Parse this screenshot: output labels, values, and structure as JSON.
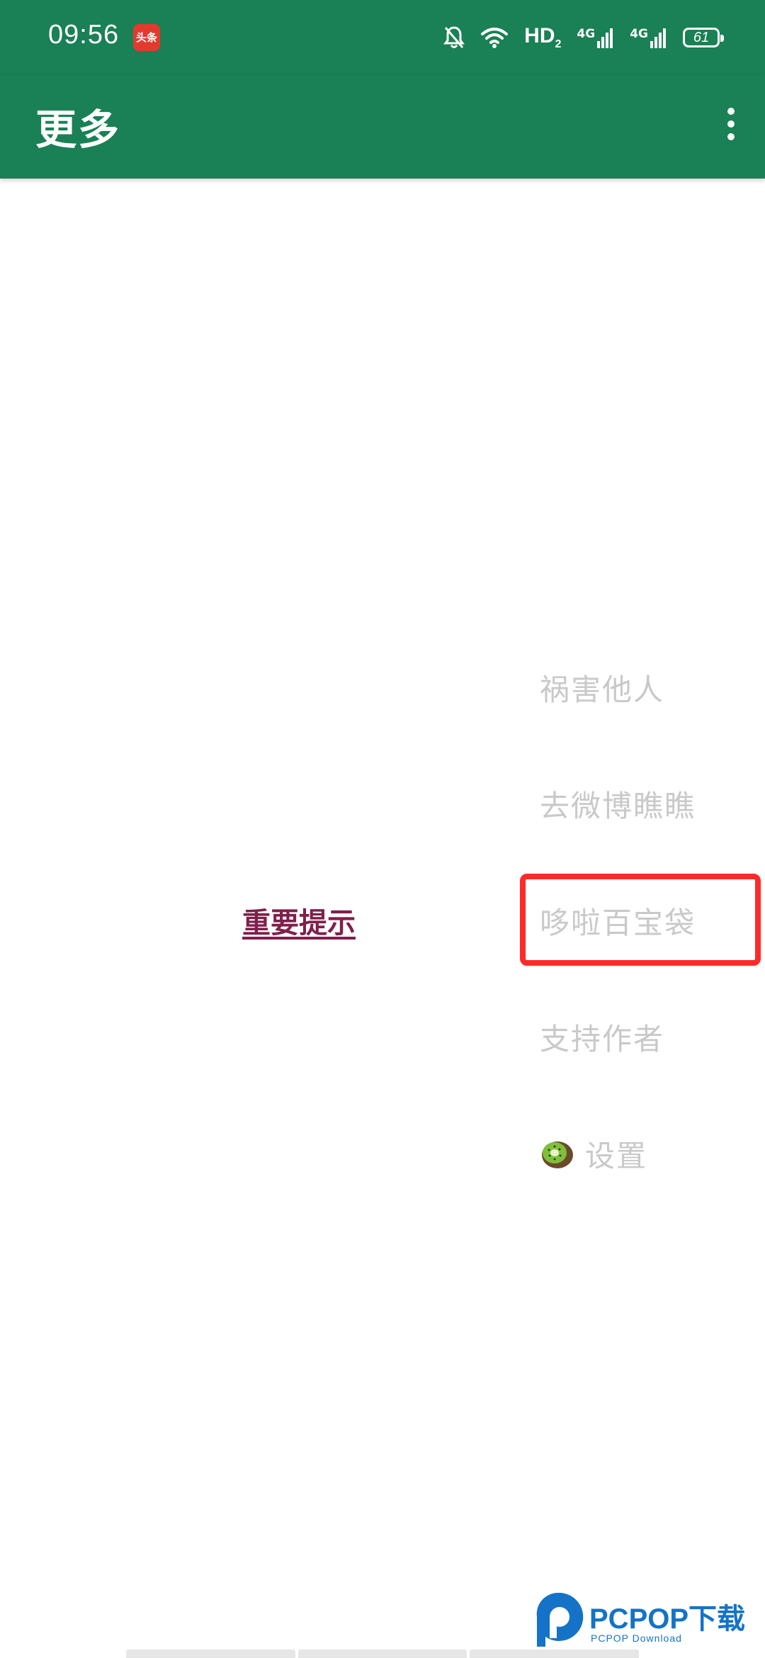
{
  "colors": {
    "brand": "#1a8055",
    "menu_text": "#c9c9c9",
    "link": "#7f1f4c",
    "highlight": "#ff2a2a"
  },
  "status_bar": {
    "time": "09:56",
    "app_icon_text": "头条",
    "icons": [
      "bell-off-icon",
      "wifi-icon",
      "hd-icon",
      "signal-4g-icon",
      "signal-4g-icon",
      "battery-icon"
    ],
    "hd": "HD",
    "hd_sub": "2",
    "net1": "4G",
    "net2": "4G",
    "battery": "61"
  },
  "app_bar": {
    "title": "更多",
    "overflow_icon": "more-vert-icon"
  },
  "main": {
    "notice_link": "重要提示"
  },
  "menu": {
    "items": [
      {
        "label": "祸害他人"
      },
      {
        "label": "去微博瞧瞧"
      },
      {
        "label": "哆啦百宝袋"
      },
      {
        "label": "支持作者"
      },
      {
        "label": "设置",
        "icon": "kiwi-icon"
      }
    ]
  },
  "watermark": {
    "brand": "PCPOP下载",
    "sub": "PCPOP Download"
  }
}
